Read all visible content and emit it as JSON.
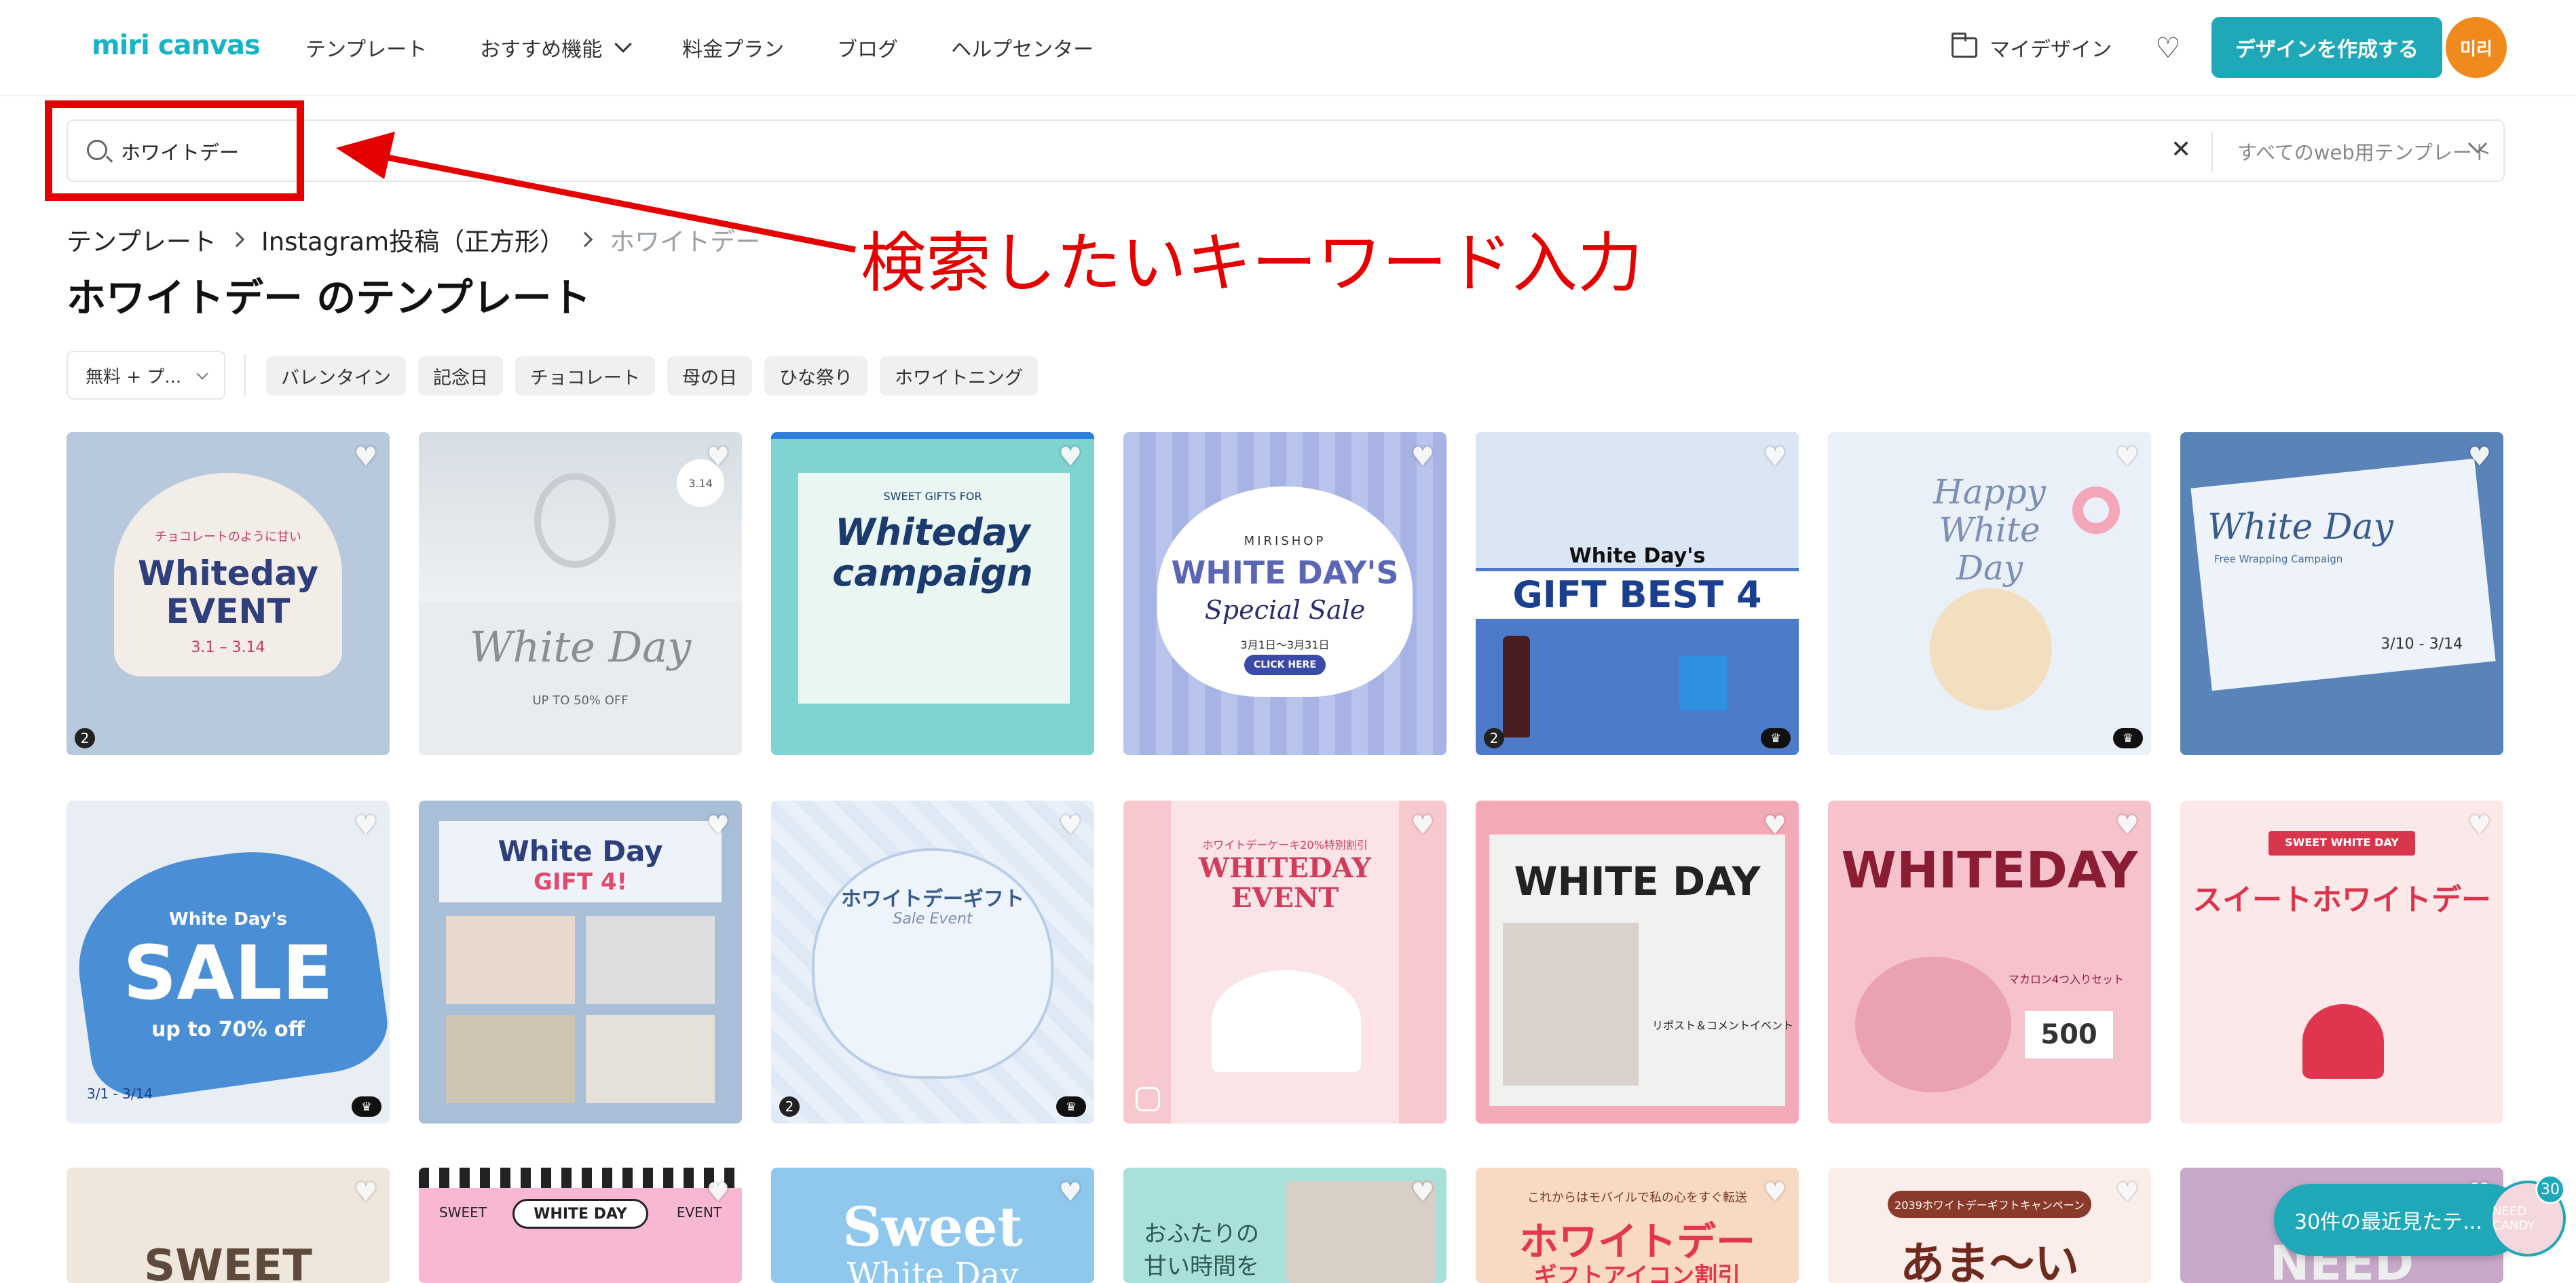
{
  "header": {
    "logo": "miri canvas",
    "nav": [
      "テンプレート",
      "おすすめ機能",
      "料金プラン",
      "ブログ",
      "ヘルプセンター"
    ],
    "my_design": "マイデザイン",
    "create_button": "デザインを作成する",
    "avatar": "미리"
  },
  "search": {
    "value": "ホワイトデー",
    "scope": "すべてのweb用テンプレート"
  },
  "annotation": {
    "text": "検索したいキーワード入力",
    "color": "#e50000"
  },
  "breadcrumb": [
    "テンプレート",
    "Instagram投稿（正方形）",
    "ホワイトデー"
  ],
  "page_title": "ホワイトデー のテンプレート",
  "filters": {
    "price": "無料 + プ...",
    "tags": [
      "バレンタイン",
      "記念日",
      "チョコレート",
      "母の日",
      "ひな祭り",
      "ホワイトニング"
    ]
  },
  "cards": [
    {
      "title": "Whiteday EVENT",
      "subtitle": "チョコレートのように甘い",
      "date": "3.1 – 3.14",
      "badge": "2"
    },
    {
      "title": "White Day",
      "subtitle": "UP TO 50% OFF",
      "date": "3.14"
    },
    {
      "title": "Whiteday campaign",
      "subtitle": "SWEET GIFTS FOR"
    },
    {
      "title": "WHITE DAY'S",
      "subtitle": "Special Sale",
      "brand": "MIRISHOP",
      "button": "CLICK HERE",
      "date": "3月1日〜3月31日"
    },
    {
      "title": "GIFT BEST 4",
      "subtitle": "White Day's",
      "badge": "2"
    },
    {
      "title": "Happy White Day",
      "subtitle": ""
    },
    {
      "title": "White Day",
      "subtitle": "Free Wrapping Campaign",
      "date": "3/10 - 3/14"
    },
    {
      "title": "SALE",
      "subtitle": "White Day's",
      "extra": "up to 70% off",
      "date": "3/1 - 3/14"
    },
    {
      "title": "White Day",
      "subtitle": "GIFT 4!"
    },
    {
      "title": "ホワイトデーギフト",
      "subtitle": "Sale Event",
      "badge": "2"
    },
    {
      "title": "WHITEDAY EVENT",
      "subtitle": "ホワイトデーケーキ20%特別割引"
    },
    {
      "title": "WHITE DAY",
      "subtitle": "リポスト＆コメントイベント"
    },
    {
      "title": "WHITEDAY",
      "subtitle": "マカロン4つ入りセット",
      "extra": "500"
    },
    {
      "title": "スイートホワイトデー",
      "subtitle": "SWEET WHITE DAY"
    },
    {
      "title": "SWEET",
      "subtitle": ""
    },
    {
      "title": "WHITE DAY",
      "subtitle": "SWEET",
      "extra": "EVENT"
    },
    {
      "title": "Sweet",
      "subtitle": "White Day"
    },
    {
      "title": "おふたりの",
      "subtitle": "甘い時間を"
    },
    {
      "title": "ホワイトデー",
      "subtitle": "これからはモバイルで私の心をすぐ転送",
      "extra": "ギフトアイコン割引"
    },
    {
      "title": "あま〜い",
      "subtitle": "2039ホワイトデーギフトキャンペーン"
    },
    {
      "title": "NEED",
      "subtitle": ""
    }
  ],
  "recent": {
    "label": "30件の最近見たテ...",
    "count": "30",
    "avatar_text": "NEED CANDY"
  }
}
